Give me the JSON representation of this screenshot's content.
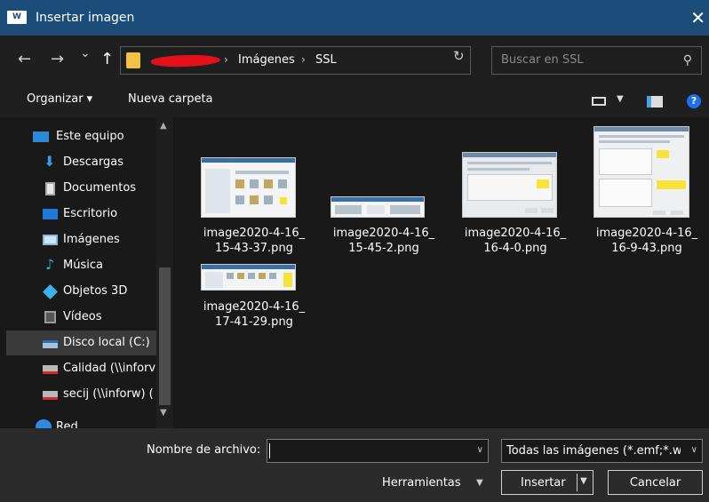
{
  "window": {
    "title": "Insertar imagen",
    "app_icon_text": "W",
    "close_glyph": "✕"
  },
  "nav": {
    "back": "←",
    "forward": "→",
    "recent": "⌄",
    "up": "↑",
    "breadcrumb": [
      "Imágenes",
      "SSL"
    ],
    "breadcrumb_sep": "›",
    "refresh": "↻",
    "search_placeholder": "Buscar en SSL"
  },
  "toolbar": {
    "organize_label": "Organizar ▾",
    "new_folder_label": "Nueva carpeta"
  },
  "sidebar": {
    "items": [
      {
        "label": "Este equipo",
        "icon": "computer-icon"
      },
      {
        "label": "Descargas",
        "icon": "download-icon"
      },
      {
        "label": "Documentos",
        "icon": "document-icon"
      },
      {
        "label": "Escritorio",
        "icon": "desktop-icon"
      },
      {
        "label": "Imágenes",
        "icon": "pictures-icon"
      },
      {
        "label": "Música",
        "icon": "music-icon"
      },
      {
        "label": "Objetos 3D",
        "icon": "objects3d-icon"
      },
      {
        "label": "Vídeos",
        "icon": "videos-icon"
      },
      {
        "label": "Disco local (C:)",
        "icon": "drive-icon",
        "selected": true
      },
      {
        "label": "Calidad (\\\\inforv",
        "icon": "network-drive-icon"
      },
      {
        "label": "secij (\\\\inforw) (",
        "icon": "network-drive-icon"
      },
      {
        "label": "Red",
        "icon": "network-icon"
      }
    ]
  },
  "files": [
    {
      "name_line1": "image2020-4-16_",
      "name_line2": "15-43-37.png"
    },
    {
      "name_line1": "image2020-4-16_",
      "name_line2": "15-45-2.png"
    },
    {
      "name_line1": "image2020-4-16_",
      "name_line2": "16-4-0.png"
    },
    {
      "name_line1": "image2020-4-16_",
      "name_line2": "16-9-43.png"
    },
    {
      "name_line1": "image2020-4-16_",
      "name_line2": "17-41-29.png"
    }
  ],
  "bottom": {
    "filename_label": "Nombre de archivo:",
    "filename_value": "",
    "filter_value": "Todas las imágenes (*.emf;*.wn",
    "tools_label": "Herramientas",
    "insert_label": "Insertar",
    "cancel_label": "Cancelar"
  },
  "colors": {
    "titlebar": "#1b4c7a",
    "background": "#191919",
    "folder": "#f3c243",
    "redaction": "#e3101b"
  }
}
